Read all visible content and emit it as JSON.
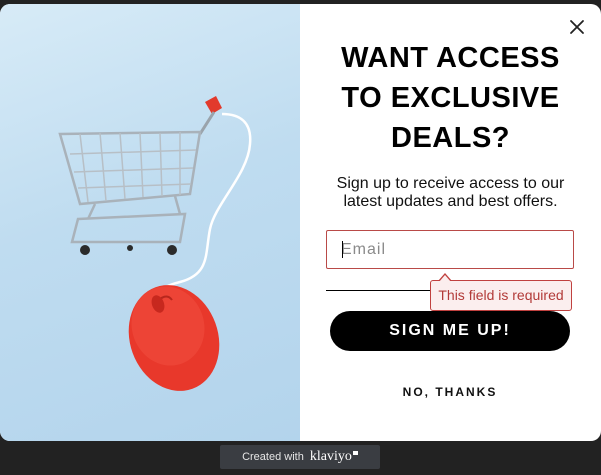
{
  "popup": {
    "headline_lines": [
      "WANT ACCESS",
      "TO EXCLUSIVE",
      "DEALS?"
    ],
    "subtext_lines": [
      "Sign up to receive access to our",
      "latest updates and best offers."
    ],
    "email": {
      "value": "",
      "placeholder": "Email"
    },
    "error_message": "This field is required",
    "signup_label": "SIGN ME UP!",
    "decline_label": "NO, THANKS",
    "image": {
      "icons": [
        "shopping-cart-icon",
        "computer-mouse-icon"
      ]
    },
    "colors": {
      "button_bg": "#000000",
      "button_text": "#ffffff",
      "error": "#b94a48",
      "image_bg": "#c7e1f2",
      "mouse": "#e8382b"
    }
  },
  "footer_badge": {
    "prefix": "Created with",
    "brand": "klaviyo"
  }
}
